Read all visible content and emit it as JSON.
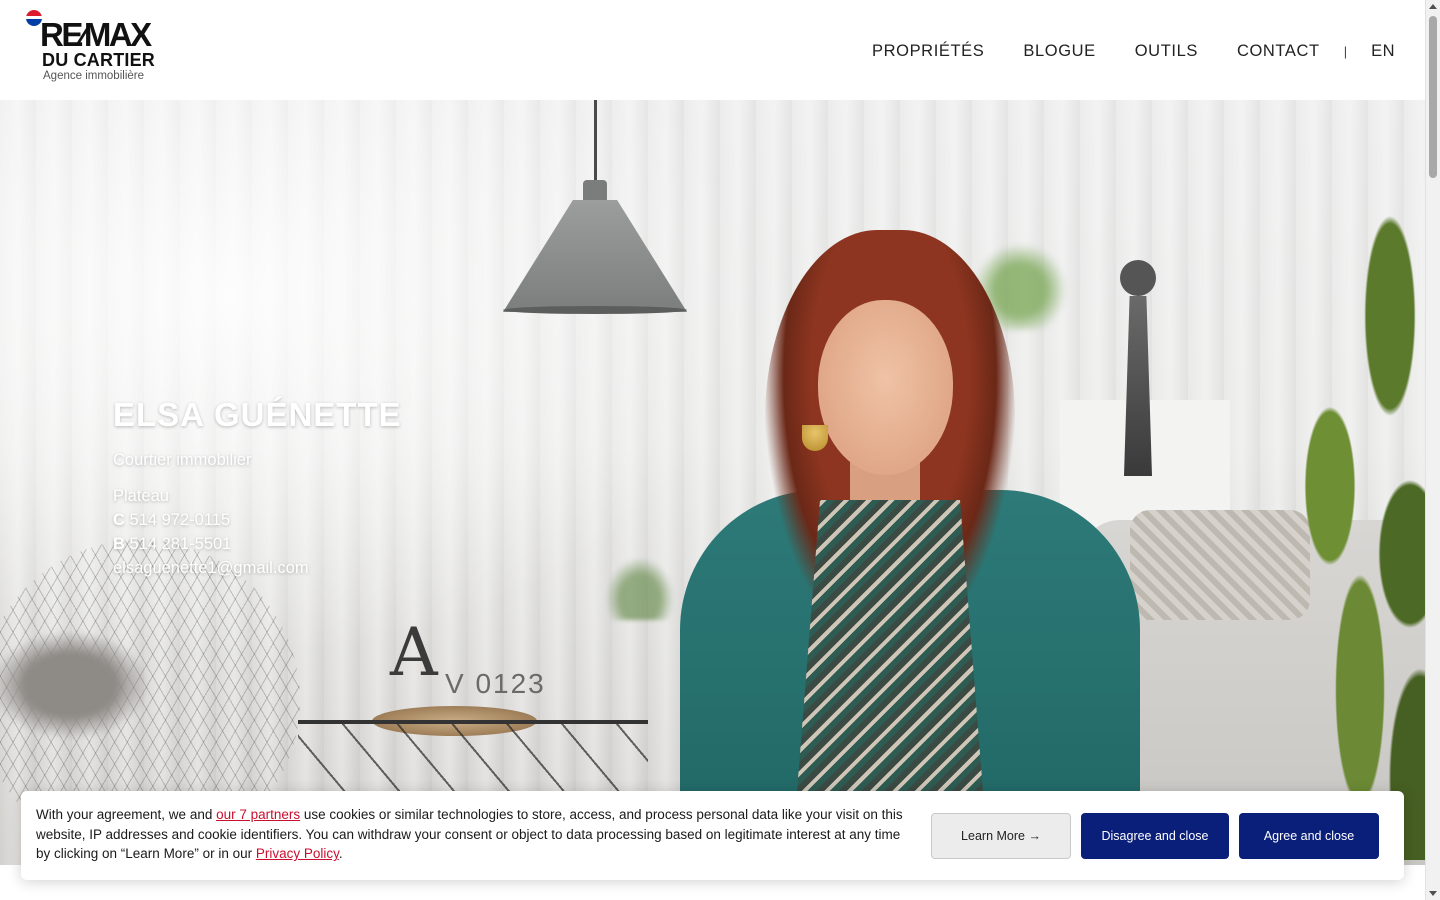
{
  "header": {
    "logo": {
      "brand": "RE/MAX",
      "brand_display": "RE⁄MAX",
      "office": "DU CARTIER",
      "tagline": "Agence immobilière"
    },
    "nav": [
      {
        "label": "PROPRIÉTÉS"
      },
      {
        "label": "BLOGUE"
      },
      {
        "label": "OUTILS"
      },
      {
        "label": "CONTACT"
      }
    ],
    "separator": "|",
    "language": "EN"
  },
  "agent": {
    "name": "ELSA GUÉNETTE",
    "title": "Courtier immobilier",
    "area": "Plateau",
    "cell_prefix": "C",
    "cell": "514 972-0115",
    "office_prefix": "B",
    "office_phone": "514 281-5501",
    "email": "elsaguenette1@gmail.com"
  },
  "hero_decor": {
    "letter_large": "A",
    "letters_small": "V 0123"
  },
  "cookie_banner": {
    "text_before_link": "With your agreement, we and ",
    "partners_link": "our 7 partners",
    "text_middle": " use cookies or similar technologies to store, access, and process personal data like your visit on this website, IP addresses and cookie identifiers. You can withdraw your consent or object to data processing based on legitimate interest at any time by clicking on “Learn More” or in our ",
    "privacy_link": "Privacy Policy",
    "text_after": ".",
    "learn_more": "Learn More →",
    "disagree": "Disagree and close",
    "agree": "Agree and close"
  },
  "colors": {
    "accent_blue": "#0a1f7a",
    "link_red": "#c8102e",
    "cardigan_teal": "#2d7a78"
  }
}
